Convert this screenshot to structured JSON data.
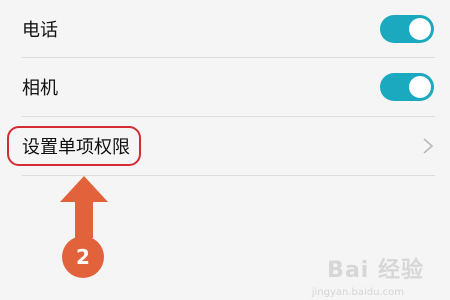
{
  "settings": {
    "items": [
      {
        "label": "电话",
        "control": "toggle",
        "enabled": true
      },
      {
        "label": "相机",
        "control": "toggle",
        "enabled": true
      },
      {
        "label": "设置单项权限",
        "control": "chevron",
        "highlighted": true
      }
    ]
  },
  "annotation": {
    "step_number": "2",
    "arrow_direction": "up"
  },
  "watermark": {
    "text": "Bai 经验",
    "subtext": "jingyan.baidu.com"
  },
  "colors": {
    "background": "#f5f5f5",
    "toggle_on": "#1aa9bf",
    "highlight_ring": "#d42c34",
    "annotation": "#e2633b",
    "chevron": "#b8b8b8"
  },
  "icons": {
    "chevron": "chevron-right-icon",
    "arrow": "arrow-up-icon"
  }
}
